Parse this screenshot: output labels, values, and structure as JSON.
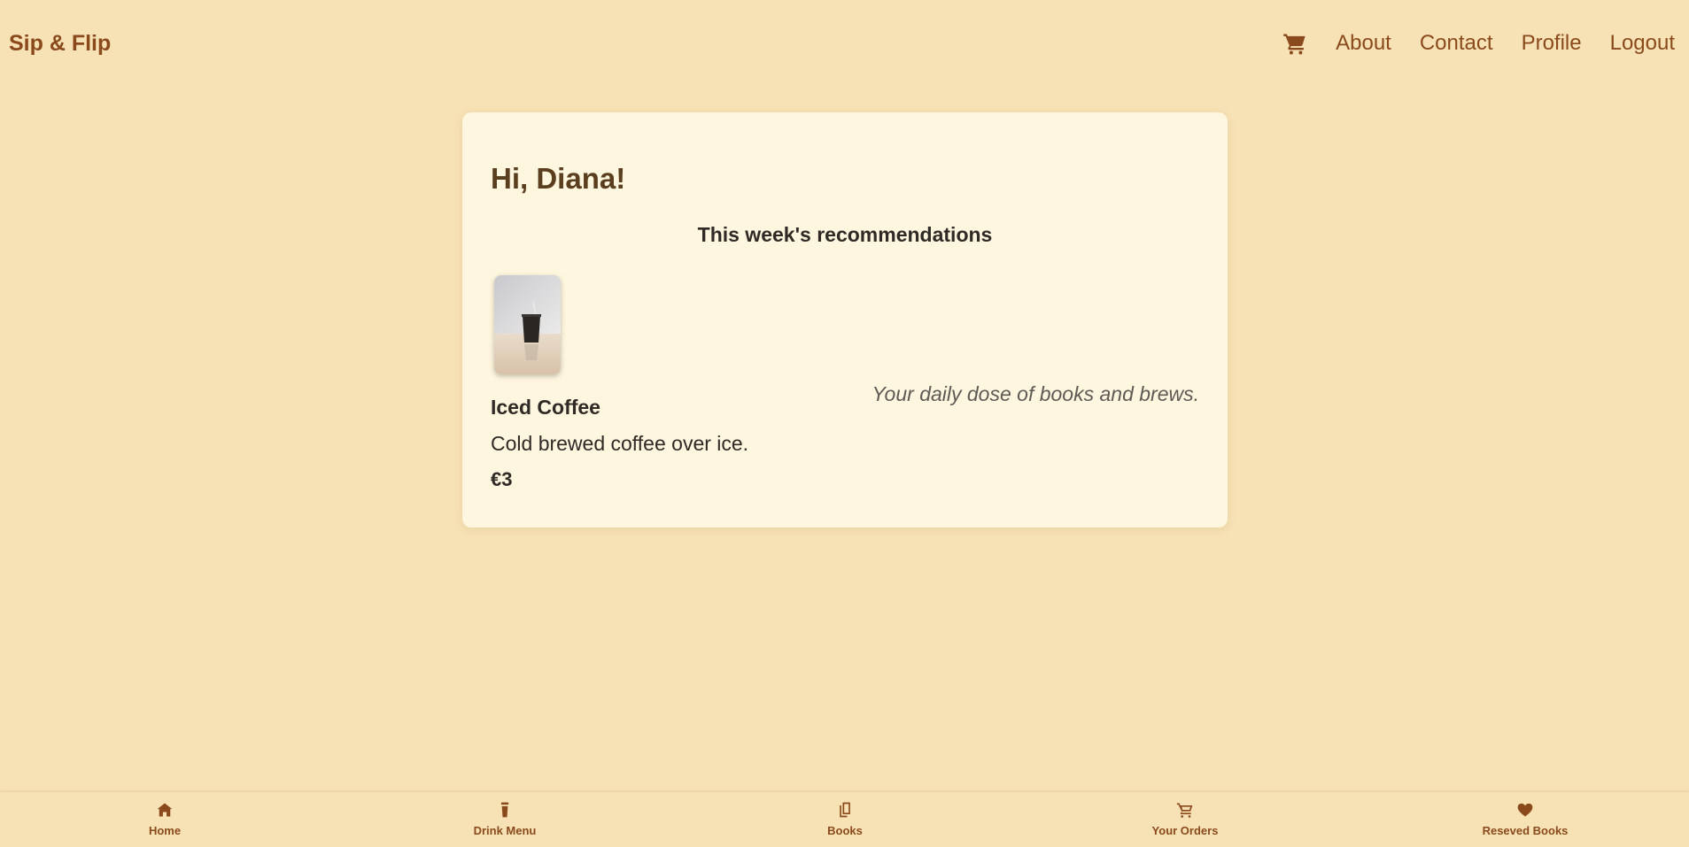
{
  "app": {
    "brand": "Sip & Flip"
  },
  "nav": {
    "cart_icon": "shopping-cart",
    "items": [
      {
        "label": "About"
      },
      {
        "label": "Contact"
      },
      {
        "label": "Profile"
      },
      {
        "label": "Logout"
      }
    ]
  },
  "main": {
    "greeting": "Hi, Diana!",
    "recommendations_title": "This week's recommendations",
    "recommendation": {
      "image": "iced-coffee-cup-photo",
      "name": "Iced Coffee",
      "description": "Cold brewed coffee over ice.",
      "price": "€3"
    },
    "tagline": "Your daily dose of books and brews."
  },
  "bottom_nav": {
    "tabs": [
      {
        "label": "Home",
        "icon": "home-icon"
      },
      {
        "label": "Drink Menu",
        "icon": "drink-icon"
      },
      {
        "label": "Books",
        "icon": "books-icon"
      },
      {
        "label": "Your Orders",
        "icon": "cart-icon"
      },
      {
        "label": "Reseved Books",
        "icon": "heart-icon"
      }
    ]
  },
  "colors": {
    "background": "#f7e2b5",
    "card": "#fef6de",
    "accent": "#8a4a1c",
    "heading": "#5a3e1e"
  }
}
